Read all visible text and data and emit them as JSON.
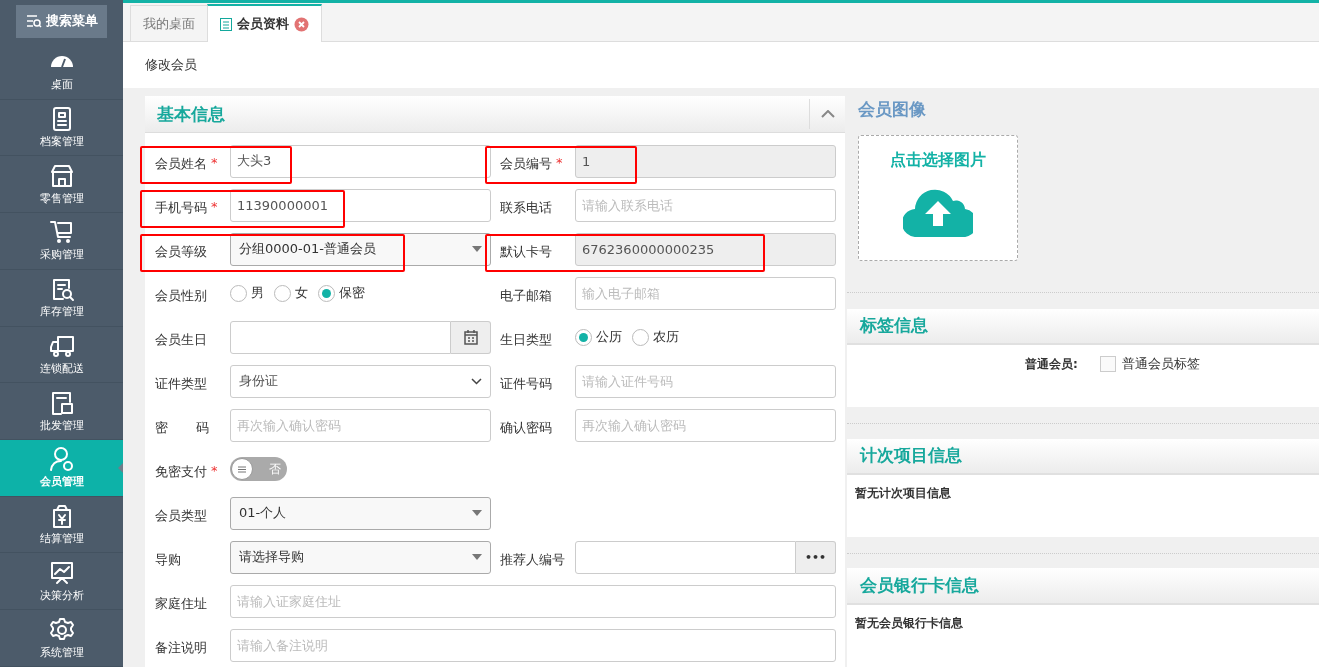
{
  "sidebar": {
    "search_button": "搜索菜单",
    "items": [
      {
        "label": "桌面",
        "selected": false
      },
      {
        "label": "档案管理",
        "selected": false
      },
      {
        "label": "零售管理",
        "selected": false
      },
      {
        "label": "采购管理",
        "selected": false
      },
      {
        "label": "库存管理",
        "selected": false
      },
      {
        "label": "连锁配送",
        "selected": false
      },
      {
        "label": "批发管理",
        "selected": false
      },
      {
        "label": "会员管理",
        "selected": true
      },
      {
        "label": "结算管理",
        "selected": false
      },
      {
        "label": "决策分析",
        "selected": false
      },
      {
        "label": "系统管理",
        "selected": false
      }
    ]
  },
  "tabs": [
    {
      "label": "我的桌面",
      "selected": false
    },
    {
      "label": "会员资料",
      "selected": true,
      "closable": true
    }
  ],
  "page_title": "修改会员",
  "form": {
    "title": "基本信息",
    "rows": [
      {
        "fields": [
          {
            "kind": "text",
            "label": "会员姓名",
            "mark": "*",
            "value": "大头3",
            "highlighted": true
          },
          {
            "kind": "text",
            "label": "会员编号",
            "mark": "*",
            "value": "1",
            "readonly": true,
            "highlighted": true
          }
        ]
      },
      {
        "fields": [
          {
            "kind": "text",
            "label": "手机号码",
            "mark": "*",
            "value": "11390000001",
            "highlighted": true
          },
          {
            "kind": "text",
            "label": "联系电话",
            "placeholder": "请输入联系电话"
          }
        ]
      },
      {
        "fields": [
          {
            "kind": "select",
            "label": "会员等级",
            "value": "分组0000-01-普通会员",
            "highlighted": true
          },
          {
            "kind": "text",
            "label": "默认卡号",
            "value": "6762360000000235",
            "readonly": true,
            "highlighted": true
          }
        ]
      },
      {
        "fields": [
          {
            "kind": "radio",
            "label": "会员性别",
            "options": [
              {
                "label": "男",
                "selected": false
              },
              {
                "label": "女",
                "selected": false
              },
              {
                "label": "保密",
                "selected": true
              }
            ]
          },
          {
            "kind": "text",
            "label": "电子邮箱",
            "placeholder": "输入电子邮箱"
          }
        ]
      },
      {
        "fields": [
          {
            "kind": "date",
            "label": "会员生日"
          },
          {
            "kind": "radio",
            "label": "生日类型",
            "options": [
              {
                "label": "公历",
                "selected": true
              },
              {
                "label": "农历",
                "selected": false
              }
            ]
          }
        ]
      },
      {
        "fields": [
          {
            "kind": "dropdown",
            "label": "证件类型",
            "value": "身份证"
          },
          {
            "kind": "text",
            "label": "证件号码",
            "placeholder": "请输入证件号码"
          }
        ]
      },
      {
        "fields": [
          {
            "kind": "text",
            "label": "密码",
            "justify": true,
            "placeholder": "再次输入确认密码"
          },
          {
            "kind": "text",
            "label": "确认密码",
            "placeholder": "再次输入确认密码"
          }
        ]
      },
      {
        "fields": [
          {
            "kind": "toggle",
            "label": "免密支付",
            "mark": "*",
            "on": false,
            "text": "否"
          }
        ]
      },
      {
        "fields": [
          {
            "kind": "select",
            "label": "会员类型",
            "value": "01-个人"
          }
        ]
      },
      {
        "fields": [
          {
            "kind": "select",
            "label": "导购",
            "value": "请选择导购"
          },
          {
            "kind": "lookup",
            "label": "推荐人编号",
            "button": "•••"
          }
        ]
      },
      {
        "fields": [
          {
            "kind": "text",
            "label": "家庭住址",
            "placeholder": "请输入证家庭住址",
            "wide": true
          }
        ]
      },
      {
        "fields": [
          {
            "kind": "text",
            "label": "备注说明",
            "placeholder": "请输入备注说明",
            "wide": true
          }
        ]
      }
    ]
  },
  "image_section": {
    "title": "会员图像",
    "upload_label": "点击选择图片"
  },
  "panels": [
    {
      "kind": "tags",
      "title": "标签信息",
      "tags": [
        {
          "group": "普通会员:",
          "label": "普通会员标签",
          "checked": false
        }
      ]
    },
    {
      "kind": "empty",
      "title": "计次项目信息",
      "message": "暂无计次项目信息"
    },
    {
      "kind": "empty",
      "title": "会员银行卡信息",
      "message": "暂无会员银行卡信息"
    }
  ]
}
